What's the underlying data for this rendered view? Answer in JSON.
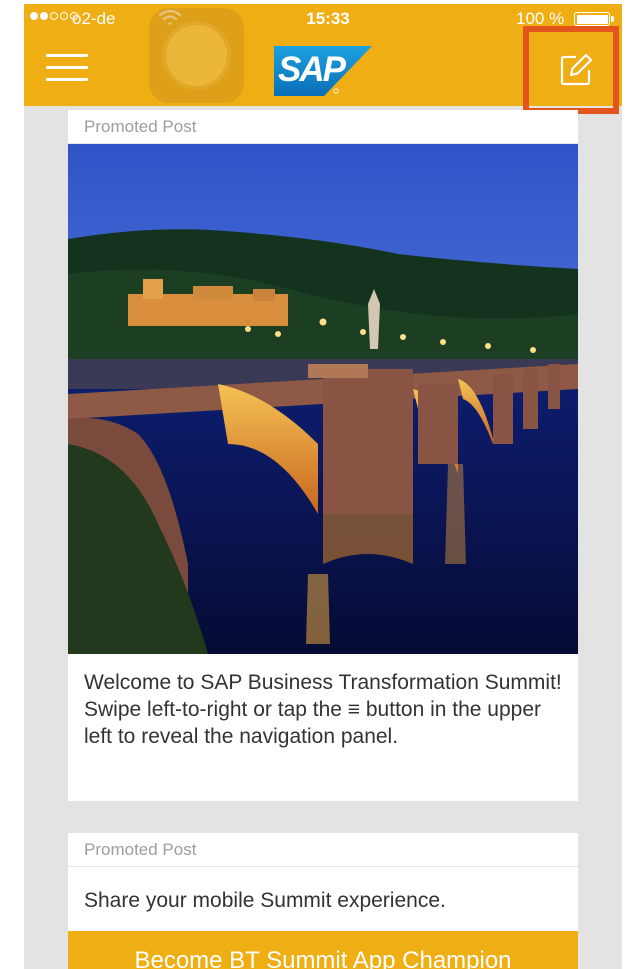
{
  "status_bar": {
    "carrier": "o2-de",
    "time": "15:33",
    "battery": "100 %"
  },
  "header": {
    "logo_text": "SAP",
    "menu_icon": "hamburger-menu-icon",
    "compose_icon": "compose-edit-icon"
  },
  "feed": {
    "posts": [
      {
        "label": "Promoted Post",
        "image": "heidelberg-old-bridge-night-photo",
        "text": "Welcome to SAP Business Transformation Summit! Swipe left-to-right   or tap the ≡ button in the upper left  to reveal the navigation panel."
      },
      {
        "label": "Promoted Post",
        "text": "Share your mobile Summit experience.",
        "button_label": "Become BT Summit App Champion"
      }
    ]
  },
  "colors": {
    "accent": "#eeae14",
    "highlight": "#e4541d",
    "background": "#e3e3e3"
  }
}
